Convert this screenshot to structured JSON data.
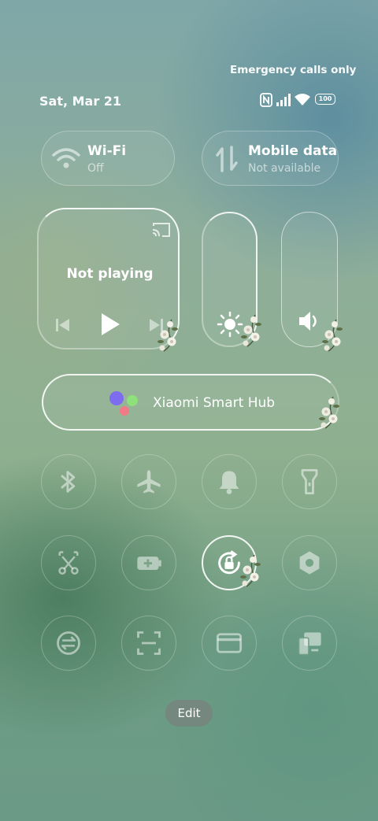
{
  "status_bar": {
    "carrier_note": "Emergency calls only",
    "date": "Sat, Mar 21",
    "battery": "100",
    "icons": [
      "nfc-icon",
      "signal-icon",
      "wifi-icon",
      "battery-icon"
    ]
  },
  "wifi_tile": {
    "title": "Wi-Fi",
    "status": "Off",
    "icon": "wifi-icon"
  },
  "mobile_tile": {
    "title": "Mobile data",
    "status": "Not available",
    "icon": "data-arrows-icon"
  },
  "media": {
    "status": "Not playing"
  },
  "smart_hub": {
    "label": "Xiaomi Smart Hub"
  },
  "toggles": [
    {
      "name": "bluetooth",
      "icon": "bluetooth-icon",
      "active": false
    },
    {
      "name": "airplane",
      "icon": "airplane-icon",
      "active": false
    },
    {
      "name": "notifications",
      "icon": "bell-icon",
      "active": false
    },
    {
      "name": "flashlight",
      "icon": "flashlight-icon",
      "active": false
    },
    {
      "name": "screenshot",
      "icon": "scissors-icon",
      "active": false
    },
    {
      "name": "battery-saver",
      "icon": "battery-plus-icon",
      "active": false
    },
    {
      "name": "rotation-lock",
      "icon": "rotation-lock-icon",
      "active": true
    },
    {
      "name": "settings",
      "icon": "hexagon-icon",
      "active": false
    },
    {
      "name": "sync",
      "icon": "sync-icon",
      "active": false
    },
    {
      "name": "scanner",
      "icon": "scan-icon",
      "active": false
    },
    {
      "name": "wallet",
      "icon": "card-icon",
      "active": false
    },
    {
      "name": "cast",
      "icon": "devices-icon",
      "active": false
    }
  ],
  "edit": {
    "label": "Edit"
  }
}
